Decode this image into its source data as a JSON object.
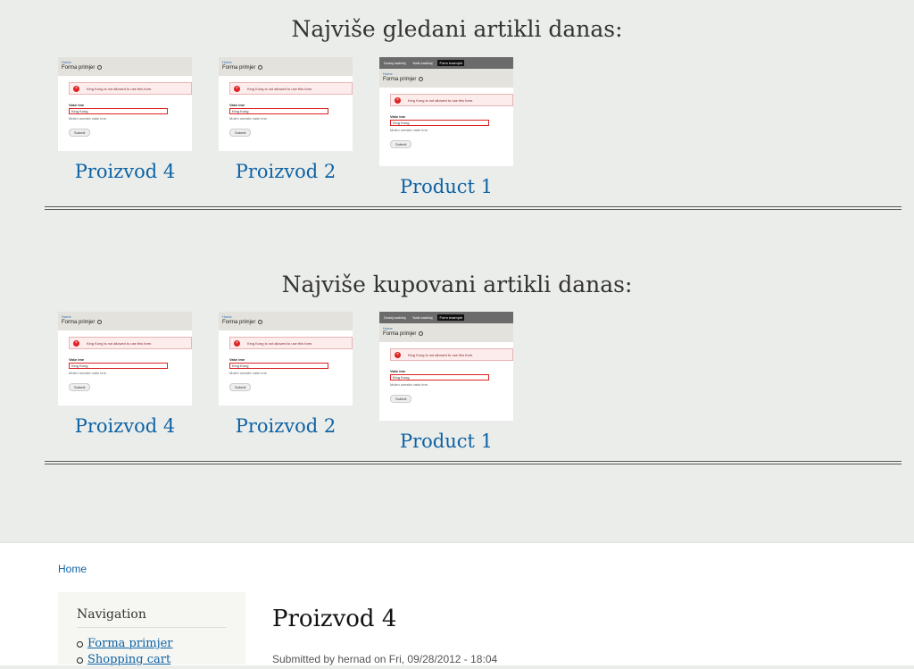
{
  "sections": [
    {
      "title": "Najviše gledani artikli danas:",
      "products": [
        {
          "name": "Proizvod 4"
        },
        {
          "name": "Proizvod 2"
        },
        {
          "name": "Product 1"
        }
      ]
    },
    {
      "title": "Najviše kupovani artikli danas:",
      "products": [
        {
          "name": "Proizvod 4"
        },
        {
          "name": "Proizvod 2"
        },
        {
          "name": "Product 1"
        }
      ]
    }
  ],
  "thumbnail": {
    "tabs": [
      "Dodaj sadržaj",
      "Naši sadržaj",
      "Form example"
    ],
    "crumb": "Home",
    "title": "Forma primjer",
    "error": "King Kong is not allowed to use this form.",
    "label": "Vaše ime",
    "value": "King Kong",
    "desc": "Molim unesite vaše ime.",
    "button": "Submit"
  },
  "breadcrumb": "Home",
  "sidebar": {
    "title": "Navigation",
    "items": [
      "Forma primjer",
      "Shopping cart"
    ]
  },
  "node": {
    "title": "Proizvod 4",
    "submitted": "Submitted by hernad on Fri, 09/28/2012 - 18:04"
  },
  "colors": {
    "link": "#0d62a5",
    "top_background": "#ebedea",
    "error": "#dd2222"
  }
}
